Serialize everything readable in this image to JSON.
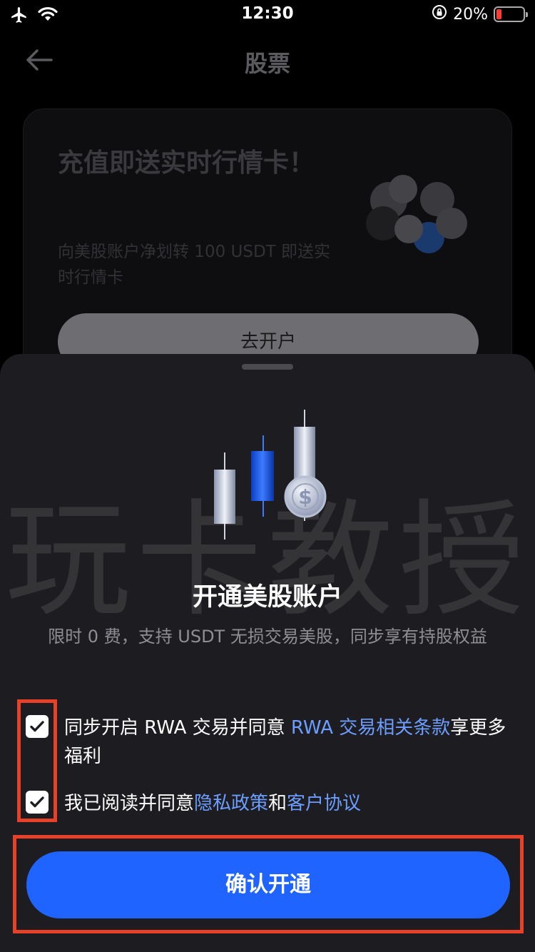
{
  "status_bar": {
    "time": "12:30",
    "battery_percent": "20%",
    "battery_level": 0.2,
    "icons": [
      "airplane-icon",
      "wifi-icon",
      "orientation-lock-icon",
      "battery-icon"
    ]
  },
  "nav": {
    "title": "股票",
    "back_icon": "arrow-left-icon"
  },
  "promo": {
    "title": "充值即送实时行情卡！",
    "description": "向美股账户净划转 100 USDT 即送实时行情卡",
    "button_label": "去开户",
    "image": "coins-icon"
  },
  "sheet": {
    "watermark": "玩卡教授",
    "hero_image": "candlestick-coin-icon",
    "title": "开通美股账户",
    "subtitle": "限时 0 费，支持 USDT 无损交易美股，同步享有持股权益",
    "agreement_1": {
      "checked": true,
      "text_before": "同步开启 RWA 交易并同意 ",
      "link": "RWA 交易相关条款",
      "text_after": "享更多福利"
    },
    "agreement_2": {
      "checked": true,
      "text_before": "我已阅读并同意",
      "link_1": "隐私政策",
      "middle": "和",
      "link_2": "客户协议"
    },
    "confirm_label": "确认开通"
  },
  "colors": {
    "accent": "#2064ff",
    "link": "#6c9dff",
    "highlight": "#e8412a",
    "sheet_bg": "#1d1d21"
  }
}
